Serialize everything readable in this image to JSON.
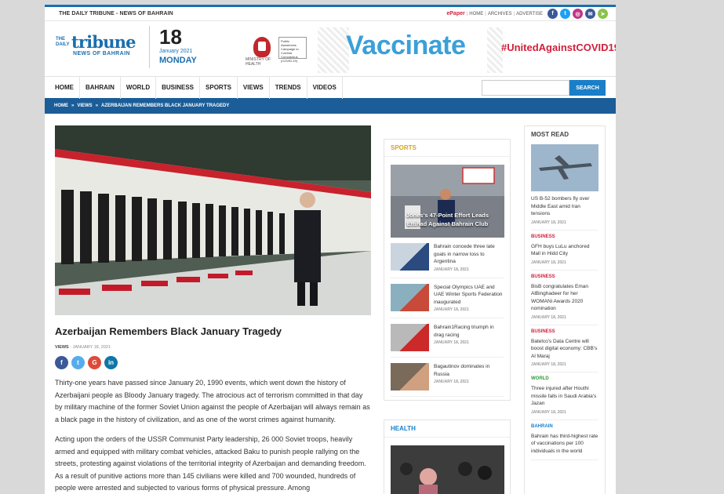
{
  "topbar": {
    "site_name": "THE DAILY TRIBUNE - NEWS OF BAHRAIN",
    "links": [
      "ePaper",
      "HOME",
      "ARCHIVES",
      "ADVERTISE"
    ],
    "social": [
      {
        "icon": "facebook-icon",
        "glyph": "f",
        "color": "#3b5998"
      },
      {
        "icon": "twitter-icon",
        "glyph": "t",
        "color": "#1da1f2"
      },
      {
        "icon": "instagram-icon",
        "glyph": "◎",
        "color": "#c13584"
      },
      {
        "icon": "email-icon",
        "glyph": "✉",
        "color": "#3b5998"
      },
      {
        "icon": "telegram-icon",
        "glyph": "➤",
        "color": "#8bc34a"
      }
    ]
  },
  "header": {
    "logo": {
      "the": "THE DAILY",
      "name": "tribune",
      "sub": "NEWS OF BAHRAIN"
    },
    "date": {
      "day": "18",
      "month_year": "January 2021",
      "weekday": "MONDAY"
    },
    "banner": {
      "ministry": "MINISTRY OF HEALTH",
      "campaign": "Public Awareness Campaign to Combat Coronavirus (COVID-19)",
      "headline": "Vaccinate",
      "hashtag": "#UnitedAgainstCOVID19"
    }
  },
  "nav": {
    "items": [
      "HOME",
      "BAHRAIN",
      "WORLD",
      "BUSINESS",
      "SPORTS",
      "VIEWS",
      "TRENDS",
      "VIDEOS"
    ],
    "search_placeholder": "",
    "search_label": "SEARCH"
  },
  "breadcrumb": [
    "HOME",
    "»",
    "VIEWS",
    "»",
    "AZERBAIJAN REMEMBERS BLACK JANUARY TRAGEDY"
  ],
  "article": {
    "title": "Azerbaijan Remembers Black January Tragedy",
    "category": "VIEWS",
    "date": "JANUARY 18, 2021",
    "share": [
      {
        "icon": "facebook-share-icon",
        "glyph": "f",
        "color": "#3b5998"
      },
      {
        "icon": "twitter-share-icon",
        "glyph": "t",
        "color": "#55acee"
      },
      {
        "icon": "google-share-icon",
        "glyph": "G",
        "color": "#dd4b39"
      },
      {
        "icon": "linkedin-share-icon",
        "glyph": "in",
        "color": "#0e76a8"
      }
    ],
    "paragraphs": [
      "Thirty-one years have passed since January 20, 1990 events, which went down the history of Azerbaijani people as Bloody January tragedy. The atrocious act of terrorism committed in that day by military machine of the former Soviet Union against the people of Azerbaijan will always remain as a black page in the history of civilization, and as one of the worst crimes against humanity.",
      "Acting upon the orders of the USSR Communist Party leadership, 26 000 Soviet troops, heavily armed and equipped with military combat vehicles, attacked Baku to punish people rallying on the streets, protesting against violations of the territorial integrity of Azerbaijan and demanding freedom. As a result of punitive actions more than 145 civilians were killed and 700 wounded, hundreds of people were arrested and subjected to various forms of physical pressure. Among"
    ]
  },
  "sports": {
    "heading": "SPORTS",
    "feature": "Jones's 47-Point Effort Leads Ettihad Against Bahrain Club",
    "items": [
      {
        "title": "Bahrain concede three late goals in narrow loss to Argentina",
        "date": "JANUARY 18, 2021"
      },
      {
        "title": "Special Olympics UAE and UAE Winter Sports Federation inaugurated",
        "date": "JANUARY 18, 2021"
      },
      {
        "title": "Bahrain1Racing triumph in drag racing",
        "date": "JANUARY 18, 2021"
      },
      {
        "title": "Bagautinov dominates in Russia",
        "date": "JANUARY 18, 2021"
      }
    ]
  },
  "health": {
    "heading": "HEALTH"
  },
  "most_read": {
    "heading": "MOST READ",
    "items": [
      {
        "cat": "",
        "title": "US B-52 bombers fly over Middle East amid Iran tensions",
        "date": "JANUARY 18, 2021"
      },
      {
        "cat": "BUSINESS",
        "title": "GFH buys LuLu anchored Mall in Hidd City",
        "date": "JANUARY 18, 2021"
      },
      {
        "cat": "BUSINESS",
        "title": "BisB congratulates Eman AlBinghadeer for her WOMANi Awards 2020 nomination",
        "date": "JANUARY 18, 2021"
      },
      {
        "cat": "BUSINESS",
        "title": "Batelco's Data Centre will boost digital economy: CBB's Al Maraj",
        "date": "JANUARY 18, 2021"
      },
      {
        "cat": "WORLD",
        "title": "Three injured after Houthi missile falls in Saudi Arabia's Jazan",
        "date": "JANUARY 18, 2021"
      },
      {
        "cat": "BAHRAIN",
        "title": "Bahrain has third-highest rate of vaccinations per 100 individuals in the world",
        "date": ""
      }
    ]
  }
}
